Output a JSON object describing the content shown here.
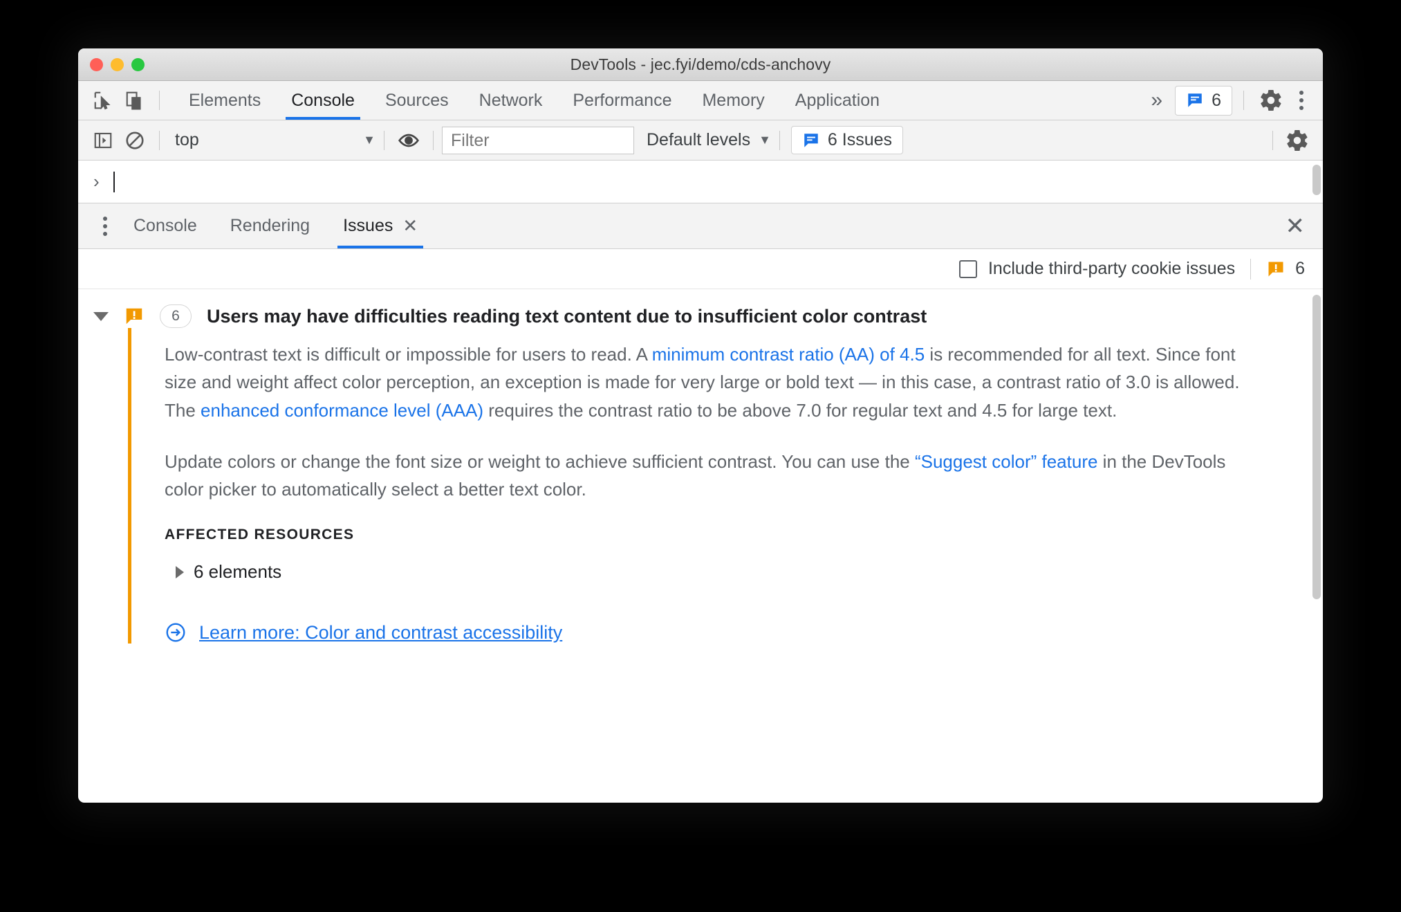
{
  "window": {
    "title": "DevTools - jec.fyi/demo/cds-anchovy",
    "traffic_lights": [
      "close",
      "minimize",
      "zoom"
    ]
  },
  "main_toolbar": {
    "inspect_icon": "inspect-cursor-icon",
    "device_toggle_icon": "device-toolbar-icon",
    "tabs": [
      {
        "label": "Elements",
        "active": false
      },
      {
        "label": "Console",
        "active": true
      },
      {
        "label": "Sources",
        "active": false
      },
      {
        "label": "Network",
        "active": false
      },
      {
        "label": "Performance",
        "active": false
      },
      {
        "label": "Memory",
        "active": false
      },
      {
        "label": "Application",
        "active": false
      }
    ],
    "more_tabs_label": "»",
    "issues_badge_count": "6",
    "settings_icon": "gear-icon",
    "more_options_icon": "kebab-menu-icon"
  },
  "console_toolbar": {
    "sidebar_toggle_icon": "console-sidebar-icon",
    "clear_icon": "clear-console-icon",
    "context": "top",
    "context_caret": "▼",
    "eye_icon": "live-expression-icon",
    "filter_placeholder": "Filter",
    "filter_value": "",
    "levels_label": "Default levels",
    "levels_caret": "▼",
    "issues_button_label": "6 Issues",
    "settings_icon": "gear-icon"
  },
  "prompt": {
    "arrow": "›",
    "value": ""
  },
  "drawer": {
    "menu_icon": "kebab-menu-icon",
    "tabs": [
      {
        "label": "Console",
        "active": false,
        "closable": false
      },
      {
        "label": "Rendering",
        "active": false,
        "closable": false
      },
      {
        "label": "Issues",
        "active": true,
        "closable": true,
        "close_glyph": "✕"
      }
    ],
    "close_drawer_glyph": "✕"
  },
  "options_row": {
    "checkbox_label": "Include third-party cookie issues",
    "checkbox_checked": false,
    "warning_icon": "warning-issue-icon",
    "warning_count": "6"
  },
  "issue": {
    "expand_glyph": "▼",
    "severity_icon": "warning-issue-icon",
    "count": "6",
    "title": "Users may have difficulties reading text content due to insufficient color contrast",
    "paragraph1": {
      "part1": "Low-contrast text is difficult or impossible for users to read. A ",
      "link1": "minimum contrast ratio (AA) of 4.5",
      "part2": " is recommended for all text. Since font size and weight affect color perception, an exception is made for very large or bold text — in this case, a contrast ratio of 3.0 is allowed. The ",
      "link2": "enhanced conformance level (AAA)",
      "part3": " requires the contrast ratio to be above 7.0 for regular text and 4.5 for large text."
    },
    "paragraph2": {
      "part1": "Update colors or change the font size or weight to achieve sufficient contrast. You can use the ",
      "link1": "“Suggest color” feature",
      "part2": " in the DevTools color picker to automatically select a better text color."
    },
    "affected_resources_heading": "AFFECTED RESOURCES",
    "affected_resources_item": "6 elements",
    "learn_more_icon": "arrow-in-circle-icon",
    "learn_more_label": "Learn more: Color and contrast accessibility"
  },
  "colors": {
    "accent_blue": "#1a73e8",
    "warning_orange": "#f29900",
    "text_primary": "#202124",
    "text_secondary": "#5f6368",
    "toolbar_bg": "#f3f3f3"
  }
}
